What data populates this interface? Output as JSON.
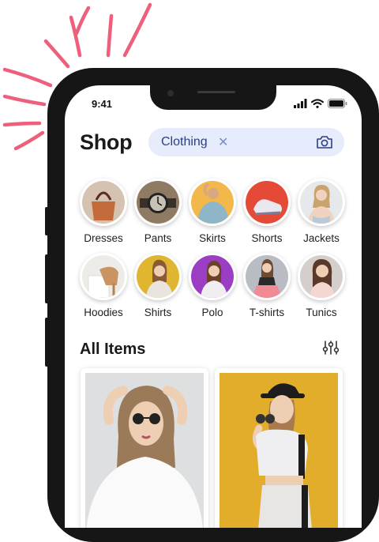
{
  "status_bar": {
    "time": "9:41"
  },
  "header": {
    "title": "Shop",
    "search": {
      "query": "Clothing",
      "clear_icon": "close-icon",
      "camera_icon": "camera-icon"
    }
  },
  "categories": [
    {
      "label": "Dresses",
      "photo": "handbag"
    },
    {
      "label": "Pants",
      "photo": "wristwatch"
    },
    {
      "label": "Skirts",
      "photo": "man in denim jacket"
    },
    {
      "label": "Shorts",
      "photo": "sneaker"
    },
    {
      "label": "Jackets",
      "photo": "woman in top"
    },
    {
      "label": "Hoodies",
      "photo": "heeled shoe"
    },
    {
      "label": "Shirts",
      "photo": "woman on yellow"
    },
    {
      "label": "Polo",
      "photo": "woman on purple"
    },
    {
      "label": "T-shirts",
      "photo": "woman in pink skirt"
    },
    {
      "label": "Tunics",
      "photo": "woman smiling"
    }
  ],
  "all_items": {
    "title": "All Items",
    "filter_icon": "sliders-icon"
  },
  "colors": {
    "accent": "#2b3e86",
    "search_bg": "#e6ecfb",
    "burst": "#ee5f7c"
  }
}
